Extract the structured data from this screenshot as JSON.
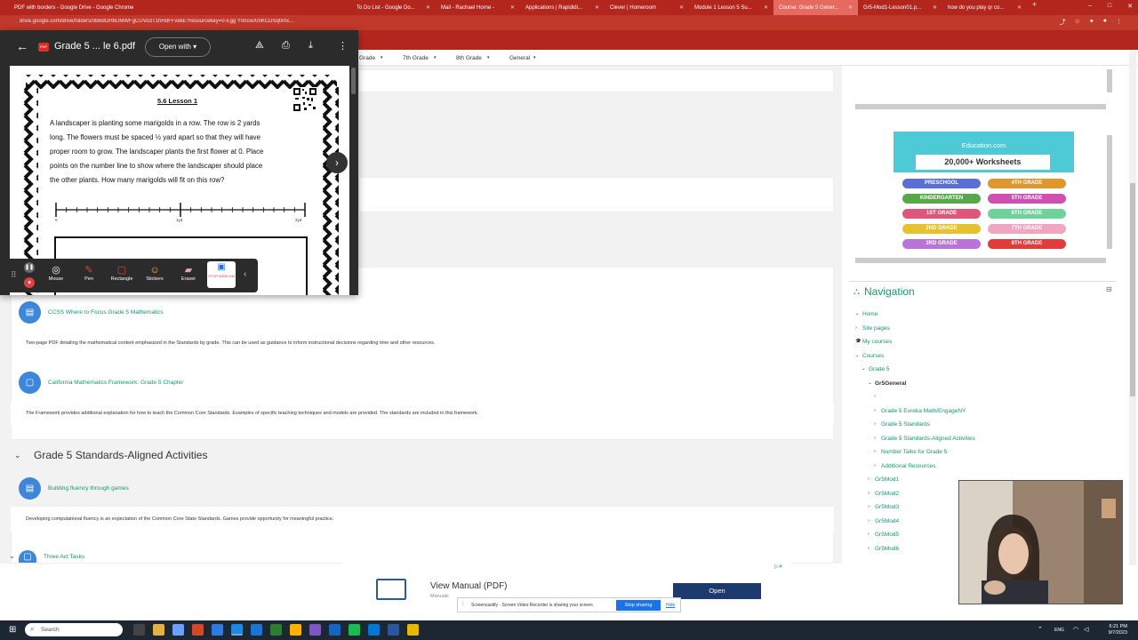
{
  "browser": {
    "window_title": "PDF with borders - Google Drive - Google Chrome",
    "url": "drive.google.com/drive/folders/0B6dOHbUMWFgCUVo3T1hHdFFvekE?resourcekey=0-Egg Y0ncwXmKCDSq0mx...",
    "tabs": [
      {
        "label": "To Do List - Google Do...",
        "active": false
      },
      {
        "label": "Mail - Rachael Horne -",
        "active": false
      },
      {
        "label": "Applications | Rapididi...",
        "active": false
      },
      {
        "label": "Clever | Homeroom",
        "active": false
      },
      {
        "label": "Module 1 Lesson 5 Su...",
        "active": false
      },
      {
        "label": "Course: Grade 5 Gener...",
        "active": true
      },
      {
        "label": "Gr5-Mod1-Lesson01.p...",
        "active": false
      },
      {
        "label": "how do you play qr co...",
        "active": false
      }
    ]
  },
  "course_nav": {
    "items": [
      "Grade",
      "7th Grade",
      "8th Grade",
      "General"
    ]
  },
  "pdf_viewer": {
    "title": "Grade 5 ... le 6.pdf",
    "open_with": "Open with",
    "page_title": "5.6 Lesson 1",
    "problem_lines": [
      "A landscaper is planting some marigolds in a row. The row is 2 yards",
      "long. The flowers must be spaced ½ yard apart so that they will have",
      "proper room to grow. The landscaper plants the first flower at 0. Place",
      "points on the number line to show where the landscaper should place",
      "the other plants. How many marigolds will fit on this row?"
    ],
    "number_line_labels": [
      "0",
      "1yd",
      "2yd"
    ]
  },
  "screencastify_toolbar": {
    "tools": [
      "Mouse",
      "Pen",
      "Rectangle",
      "Stickers",
      "Eraser",
      "STOP WEBCAM"
    ]
  },
  "activities": [
    {
      "title": "CCSS Where to Focus Grade 5 Mathematics",
      "description": "Two-page PDF detailing the mathematical content emphasized in the Standards by grade. This can be used as guidance to inform instructional decisions regarding time and other resources."
    },
    {
      "title": "California Mathematics Framework: Grade 5 Chapter",
      "description": "The Framework provides additional explanation for how to teach the Common Core Standards. Examples of specific teaching techniques and models are provided. The standards are included in this framework."
    }
  ],
  "section": {
    "title": "Grade 5 Standards-Aligned Activities",
    "activities": [
      {
        "title": "Building fluency through games",
        "description": "Developing computational fluency is an expectation of the Common Core State Standards. Games provide opportunity for meaningful practice."
      },
      {
        "title": "Three Act Tasks"
      }
    ]
  },
  "ad_top": {
    "brand": "Education.com",
    "headline": "20,000+ Worksheets",
    "buttons": [
      {
        "label": "PRESCHOOL",
        "color": "#5b6ed6"
      },
      {
        "label": "4TH GRADE",
        "color": "#e0962c"
      },
      {
        "label": "KINDERGARTEN",
        "color": "#58a84a"
      },
      {
        "label": "5TH GRADE",
        "color": "#d14fb0"
      },
      {
        "label": "1ST GRADE",
        "color": "#e0557a"
      },
      {
        "label": "6TH GRADE",
        "color": "#6fd29a"
      },
      {
        "label": "2ND GRADE",
        "color": "#e6c22f"
      },
      {
        "label": "7TH GRADE",
        "color": "#f0a5c0"
      },
      {
        "label": "3RD GRADE",
        "color": "#b874d6"
      },
      {
        "label": "8TH GRADE",
        "color": "#e23b3b"
      }
    ]
  },
  "navigation": {
    "title": "Navigation",
    "items": [
      {
        "label": "Home",
        "level": 0
      },
      {
        "label": "Site pages",
        "level": 0
      },
      {
        "label": "My courses",
        "level": 0
      },
      {
        "label": "Courses",
        "level": 0
      },
      {
        "label": "Grade 5",
        "level": 1
      },
      {
        "label": "Gr5General",
        "level": 2
      },
      {
        "label": "",
        "level": 3
      },
      {
        "label": "Grade 5 Eureka Math/EngageNY",
        "level": 3
      },
      {
        "label": "Grade 5 Standards",
        "level": 3
      },
      {
        "label": "Grade 5 Standards-Aligned Activities",
        "level": 3
      },
      {
        "label": "Number Talks for Grade 5",
        "level": 3
      },
      {
        "label": "Additional Resources",
        "level": 3
      },
      {
        "label": "Gr5Mod1",
        "level": 2
      },
      {
        "label": "Gr5Mod2",
        "level": 2
      },
      {
        "label": "Gr5Mod3",
        "level": 2
      },
      {
        "label": "Gr5Mod4",
        "level": 2
      },
      {
        "label": "Gr5Mod5",
        "level": 2
      },
      {
        "label": "Gr5Mod6",
        "level": 2
      }
    ]
  },
  "ad_bottom": {
    "title": "View Manual (PDF)",
    "subtitle": "Manuals",
    "button": "Open"
  },
  "share_bar": {
    "text": "Screencastify - Screen Video Recorder is sharing your screen.",
    "stop": "Stop sharing",
    "hide": "Hide"
  },
  "taskbar": {
    "search": "Search",
    "lang": "ENG",
    "time": "6:21 PM",
    "date": "9/7/2023"
  }
}
